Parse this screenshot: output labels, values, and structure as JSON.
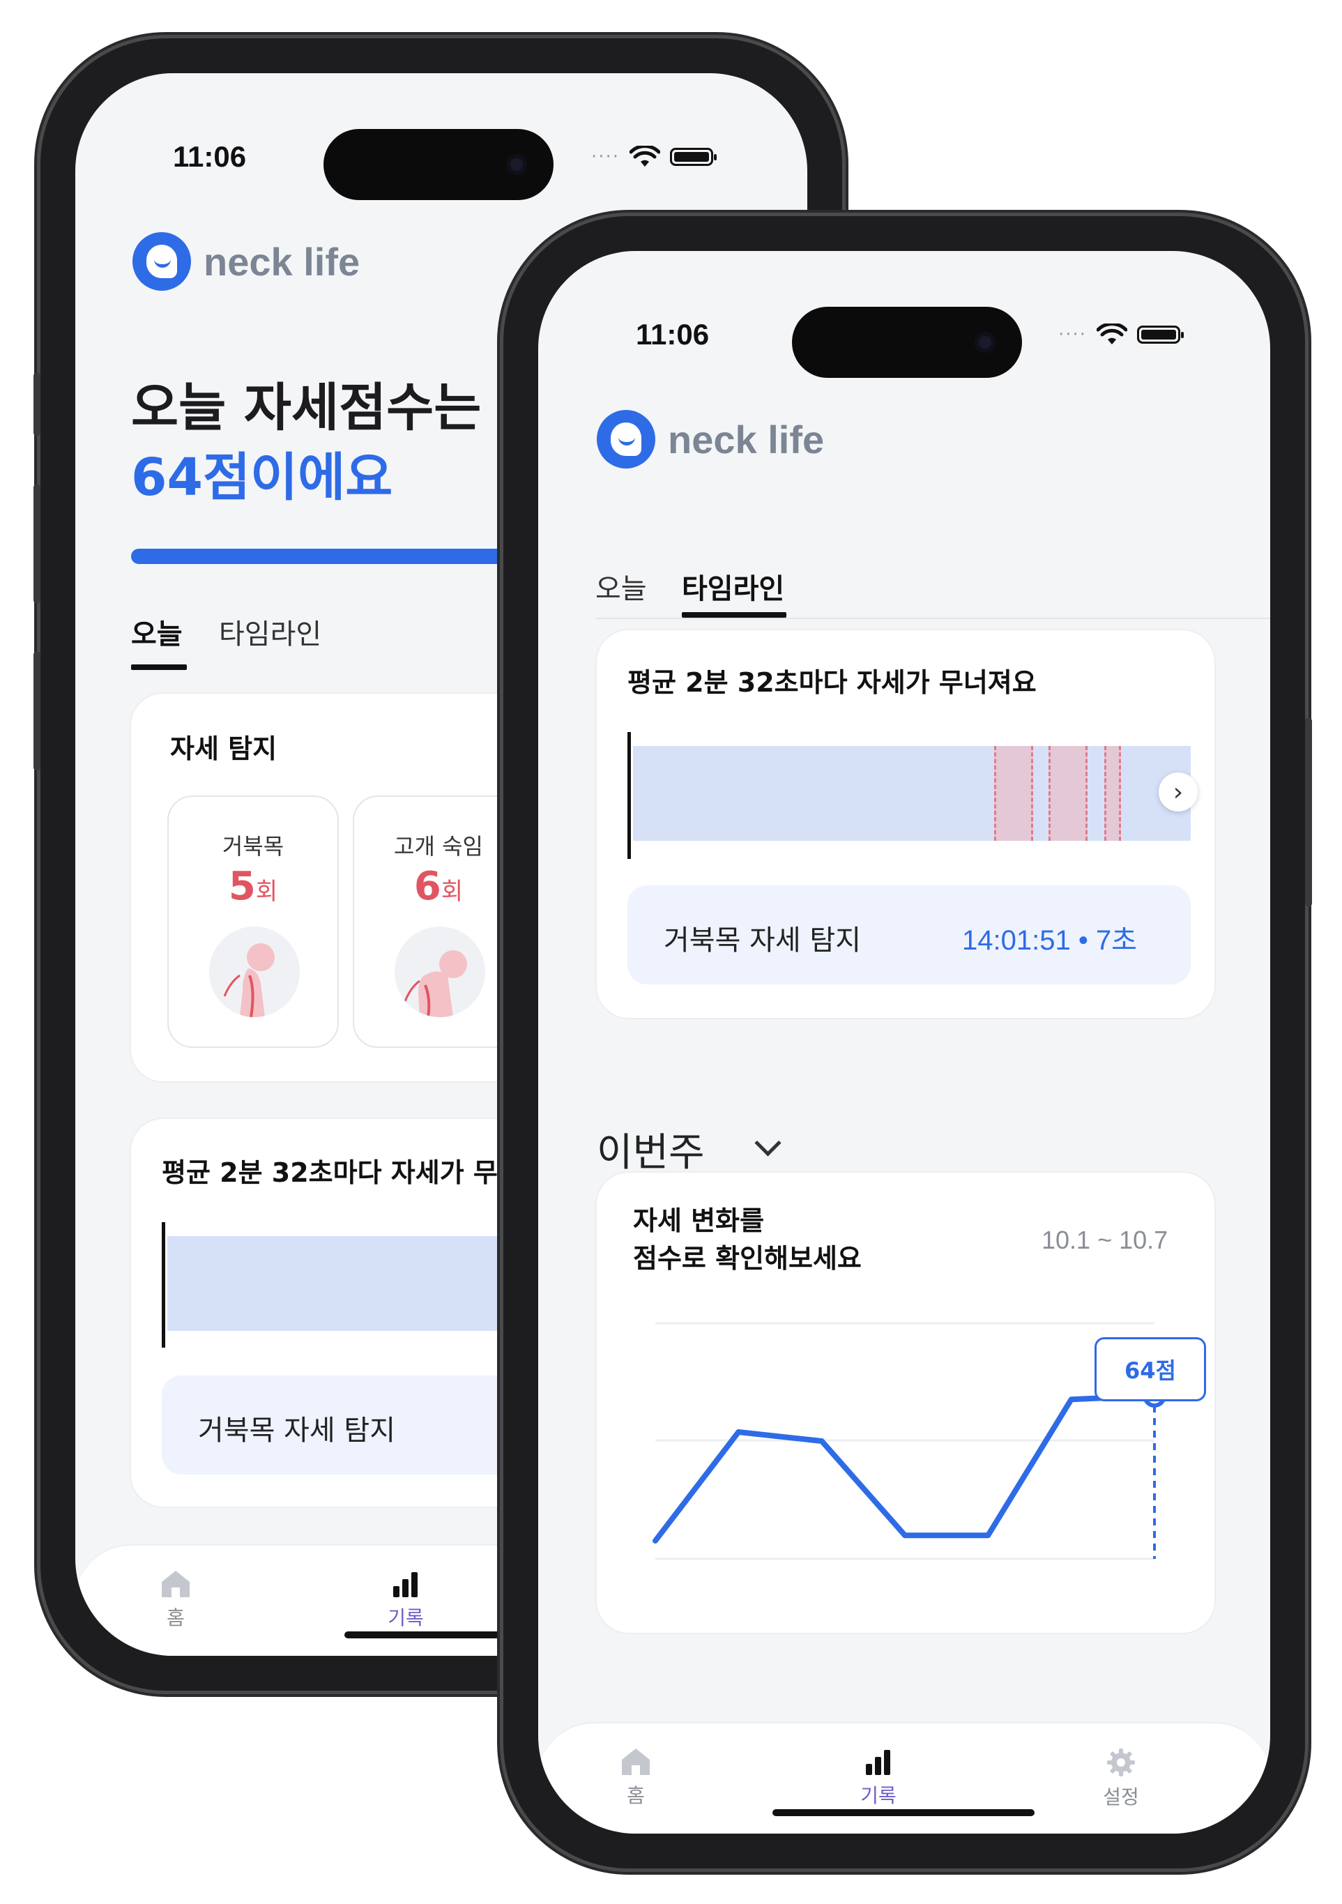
{
  "status": {
    "time": "11:06",
    "dots": "····"
  },
  "brand": {
    "name": "neck life"
  },
  "home": {
    "title_line1": "오늘 자세점수는",
    "title_line2": "64점이에요",
    "progress": 0.64
  },
  "segment": {
    "tabs": [
      "오늘",
      "타임라인"
    ]
  },
  "detection": {
    "title": "자세 탐지",
    "items": [
      {
        "label": "거북목",
        "count": "5",
        "unit": "회"
      },
      {
        "label": "고개 숙임",
        "count": "6",
        "unit": "회"
      }
    ]
  },
  "timeline": {
    "title": "평균 2분 32초마다 자세가 무너져요",
    "title_partial": "평균 2분 32초마다 자세가 무",
    "event_label": "거북목 자세 탐지",
    "event_time": "14:01:51 • 7초",
    "event_time_partial": "1"
  },
  "week": {
    "title": "이번주",
    "card_title_line1": "자세 변화를",
    "card_title_line2": "점수로 확인해보세요",
    "date_range": "10.1 ~ 10.7",
    "badge": "64점"
  },
  "chart_data": {
    "type": "line",
    "values": [
      56,
      62,
      61.5,
      56.3,
      56.3,
      63.8,
      64
    ],
    "ylim": [
      55,
      68
    ],
    "highlight_index": 6,
    "color": "#2e6be6"
  },
  "tabbar": {
    "items": [
      {
        "label": "홈",
        "icon": "home-icon"
      },
      {
        "label": "기록",
        "icon": "bar-chart-icon"
      },
      {
        "label": "설정",
        "icon": "gear-icon"
      }
    ]
  },
  "colors": {
    "accent": "#2e6be6",
    "warning": "#e05561",
    "tab_active": "#6b5ec9"
  }
}
